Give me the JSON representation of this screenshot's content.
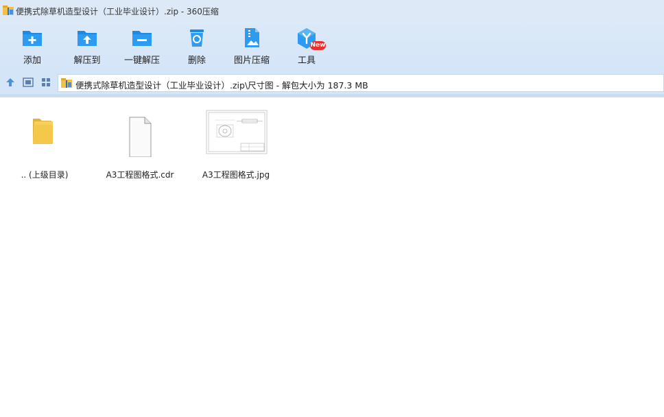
{
  "window": {
    "title": "便携式除草机造型设计（工业毕业设计）.zip - 360压缩"
  },
  "toolbar": {
    "items": [
      {
        "label": "添加",
        "icon": "add-folder-icon"
      },
      {
        "label": "解压到",
        "icon": "extract-to-folder-icon"
      },
      {
        "label": "一键解压",
        "icon": "one-click-extract-icon"
      },
      {
        "label": "删除",
        "icon": "recycle-bin-icon"
      },
      {
        "label": "图片压缩",
        "icon": "image-compress-icon"
      },
      {
        "label": "工具",
        "icon": "tools-cube-icon"
      }
    ],
    "new_badge": "New"
  },
  "address": {
    "path": "便携式除草机造型设计（工业毕业设计）.zip\\尺寸图 - 解包大小为 187.3 MB"
  },
  "files": [
    {
      "name": ".. (上级目录)",
      "icon": "folder-icon"
    },
    {
      "name": "A3工程图格式.cdr",
      "icon": "file-icon"
    },
    {
      "name": "A3工程图格式.jpg",
      "icon": "image-thumbnail"
    }
  ],
  "colors": {
    "accent": "#1a8ce6",
    "toolbar_bg": "#d4e5f8",
    "badge": "#e8312f",
    "folder": "#f4c84a"
  }
}
